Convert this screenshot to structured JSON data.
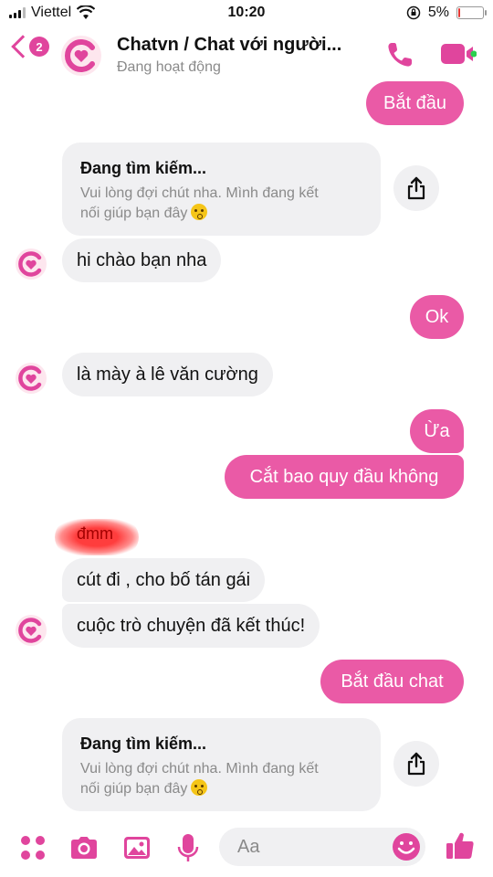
{
  "status_bar": {
    "carrier": "Viettel",
    "time": "10:20",
    "battery": "5%",
    "battery_level": 0.05
  },
  "header": {
    "back_badge": "2",
    "title": "Chatvn / Chat với người...",
    "subtitle": "Đang hoạt động"
  },
  "messages": {
    "m1": "Bắt đầu",
    "card1": {
      "title": "Đang tìm kiếm...",
      "line1": "Vui lòng đợi chút nha. Mình đang kết",
      "line2": "nối giúp bạn đây"
    },
    "m2": "hi chào bạn nha",
    "m3": "Ok",
    "m4": "là mày à lê văn cường",
    "m5": "Ừa",
    "m6": "Cắt bao quy đầu không",
    "m7_tag": "đmm",
    "m8": "cút đi , cho bố tán gái",
    "m9": "cuộc trò chuyện đã kết thúc!",
    "m10": "Bắt đầu chat",
    "card2": {
      "title": "Đang tìm kiếm...",
      "line1": "Vui lòng đợi chút nha. Mình đang kết",
      "line2": "nối giúp bạn đây"
    }
  },
  "composer": {
    "placeholder": "Aa"
  },
  "colors": {
    "accent": "#ea5aa6",
    "incoming_bg": "#f0f0f2",
    "subtle_text": "#8a8a8a"
  }
}
